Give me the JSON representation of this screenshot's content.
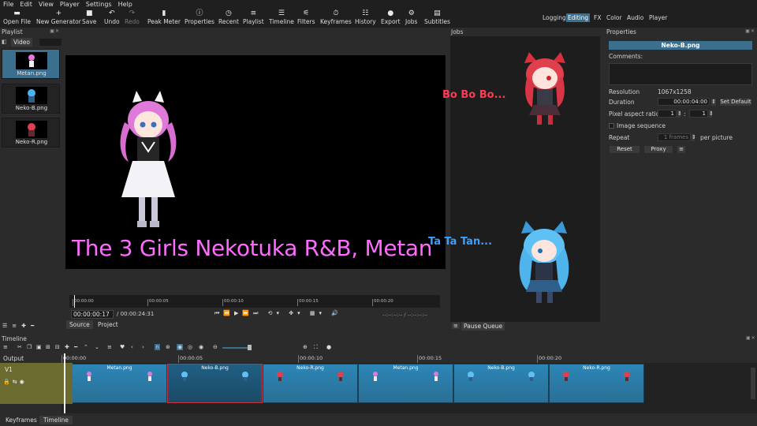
{
  "menu": [
    "File",
    "Edit",
    "View",
    "Player",
    "Settings",
    "Help"
  ],
  "toolbar": {
    "buttons": [
      {
        "label": "Open File",
        "icon": "folder-icon"
      },
      {
        "label": "New Generator",
        "icon": "plus-icon"
      },
      {
        "label": "Save",
        "icon": "save-icon"
      },
      {
        "label": "Undo",
        "icon": "undo-icon"
      },
      {
        "label": "Redo",
        "icon": "redo-icon"
      },
      {
        "label": "Peak Meter",
        "icon": "meter-icon"
      },
      {
        "label": "Properties",
        "icon": "info-icon"
      },
      {
        "label": "Recent",
        "icon": "clock-icon"
      },
      {
        "label": "Playlist",
        "icon": "list-icon"
      },
      {
        "label": "Timeline",
        "icon": "timeline-icon"
      },
      {
        "label": "Filters",
        "icon": "filter-icon"
      },
      {
        "label": "Keyframes",
        "icon": "stopwatch-icon"
      },
      {
        "label": "History",
        "icon": "history-icon"
      },
      {
        "label": "Export",
        "icon": "export-icon"
      },
      {
        "label": "Jobs",
        "icon": "gear-icon"
      },
      {
        "label": "Subtitles",
        "icon": "subtitles-icon"
      }
    ],
    "layouts": [
      "Logging",
      "Editing",
      "FX",
      "Color",
      "Audio",
      "Player"
    ],
    "active_layout": "Editing"
  },
  "playlist": {
    "title": "Playlist",
    "tab": "Video",
    "items": [
      "Metan.png",
      "Neko-B.png",
      "Neko-R.png"
    ]
  },
  "player": {
    "caption": "The 3 Girls Nekotuka R&B, Metan",
    "ruler_ticks": [
      "00:00:00",
      "00:00:05",
      "00:00:10",
      "00:00:15",
      "00:00:20"
    ],
    "timecode": "00:00:00:17",
    "duration": "/  00:00:24:31",
    "in_out": "--:--:--:-- / --:--:--:--",
    "tabs": [
      "Source",
      "Project"
    ]
  },
  "jobs": {
    "title": "Jobs",
    "text1": "Bo Bo Bo...",
    "text2": "Ta Ta Tan...",
    "pause_label": "Pause Queue"
  },
  "properties": {
    "title": "Properties",
    "name": "Neko-B.png",
    "comments_label": "Comments:",
    "resolution_label": "Resolution",
    "resolution": "1067x1258",
    "duration_label": "Duration",
    "duration": "00:00:04:00",
    "set_default": "Set Default",
    "par_label": "Pixel aspect ratio",
    "par_num": "1",
    "par_sep": ":",
    "par_den": "1",
    "image_seq_label": "Image sequence",
    "repeat_label": "Repeat",
    "repeat_value": "1 frames",
    "repeat_suffix": "per picture",
    "reset": "Reset",
    "proxy": "Proxy"
  },
  "timeline": {
    "title": "Timeline",
    "output_label": "Output",
    "track": "V1",
    "ruler_ticks": [
      "00:00:00",
      "00:00:05",
      "00:00:10",
      "00:00:15",
      "00:00:20"
    ],
    "clips": [
      "Metan.png",
      "Neko-B.png",
      "Neko-R.png",
      "Metan.png",
      "Neko-B.png",
      "Neko-R.png"
    ]
  },
  "bottom_tabs": [
    "Keyframes",
    "Timeline"
  ],
  "colors": {
    "accent": "#3c6f8e",
    "caption": "#ff6bff",
    "red_text": "#ff3a55",
    "blue_text": "#3aa0ff",
    "clip": "#2c86b7",
    "track": "#6b6b2f"
  }
}
